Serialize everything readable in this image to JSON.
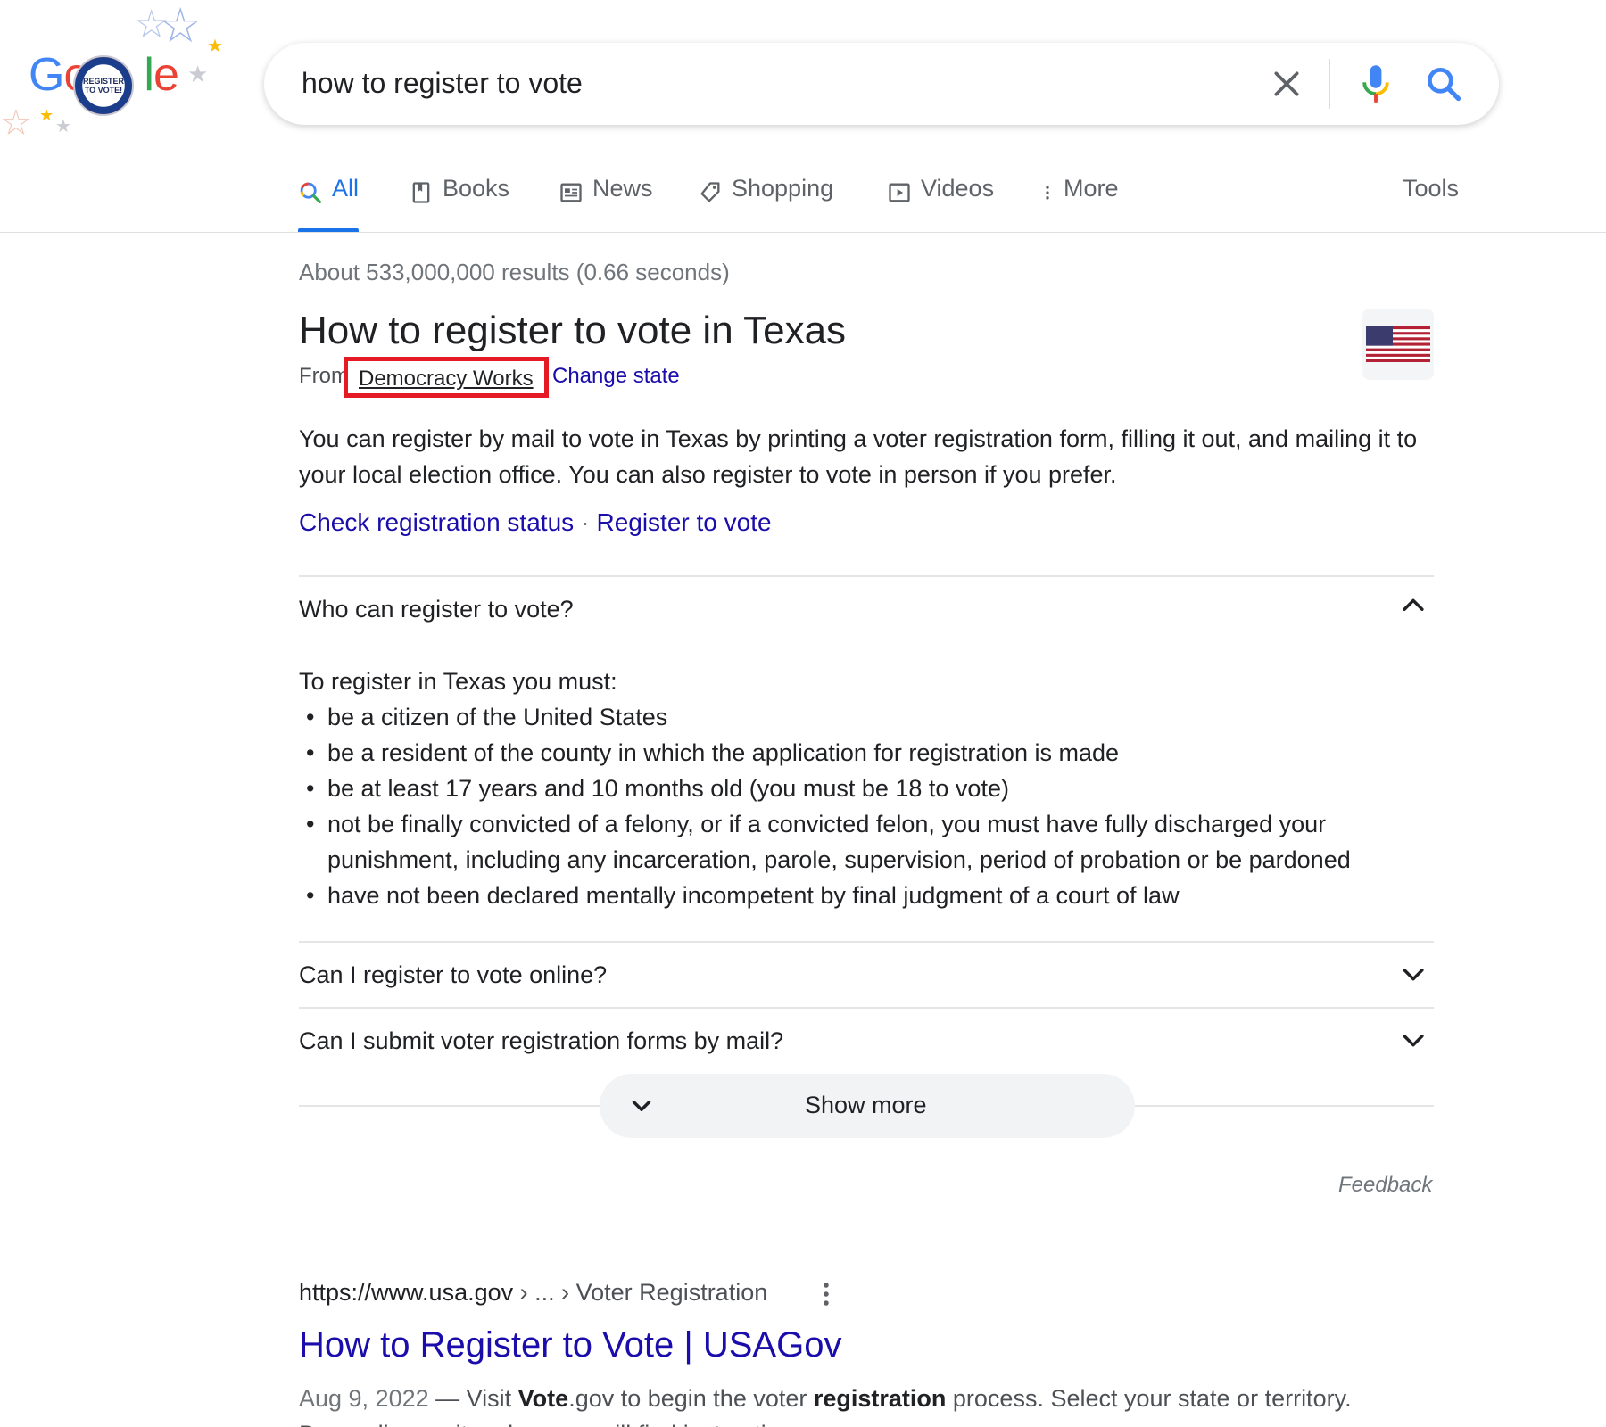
{
  "logo": {
    "letters": [
      "G",
      "o",
      "o",
      "g",
      "l",
      "e"
    ],
    "badge_line1": "REGISTER",
    "badge_line2": "TO VOTE!",
    "colors": {
      "blue": "#4285f4",
      "red": "#ea4335",
      "yellow": "#fbbc05",
      "green": "#34a853"
    }
  },
  "search": {
    "query": "how to register to vote"
  },
  "tabs": [
    {
      "label": "All",
      "icon": "search-icon",
      "active": true
    },
    {
      "label": "Books",
      "icon": "book-icon"
    },
    {
      "label": "News",
      "icon": "newspaper-icon"
    },
    {
      "label": "Shopping",
      "icon": "tag-icon"
    },
    {
      "label": "Videos",
      "icon": "play-icon"
    },
    {
      "label": "More",
      "icon": "more-vert-icon"
    }
  ],
  "tools_label": "Tools",
  "result_stats": "About 533,000,000 results (0.66 seconds)",
  "knowledge_panel": {
    "title": "How to register to vote in Texas",
    "from_label": "From",
    "source": "Democracy Works",
    "change_state": "Change state",
    "description": "You can register by mail to vote in Texas by printing a voter registration form, filling it out, and mailing it to your local election office. You can also register to vote in person if you prefer.",
    "links": [
      "Check registration status",
      "Register to vote"
    ],
    "accordion": [
      {
        "question": "Who can register to vote?",
        "expanded": true,
        "intro": "To register in Texas you must:",
        "items": [
          "be a citizen of the United States",
          "be a resident of the county in which the application for registration is made",
          "be at least 17 years and 10 months old (you must be 18 to vote)",
          "not be finally convicted of a felony, or if a convicted felon, you must have fully discharged your punishment, including any incarceration, parole, supervision, period of probation or be pardoned",
          "have not been declared mentally incompetent by final judgment of a court of law"
        ]
      },
      {
        "question": "Can I register to vote online?",
        "expanded": false
      },
      {
        "question": "Can I submit voter registration forms by mail?",
        "expanded": false
      }
    ],
    "show_more": "Show more",
    "feedback": "Feedback"
  },
  "result": {
    "url": "https://www.usa.gov",
    "breadcrumb": " › ... › Voter Registration",
    "title": "How to Register to Vote | USAGov",
    "date": "Aug 9, 2022",
    "dash": " — Visit ",
    "bold1": "Vote",
    "part2": ".gov to begin the voter ",
    "bold2": "registration",
    "part3": " process. Select your state or territory. Depending on its rules, you will find instructions"
  },
  "accent_color": "#1a73e8",
  "link_color": "#1a0dab",
  "highlight_color": "#e41a24"
}
